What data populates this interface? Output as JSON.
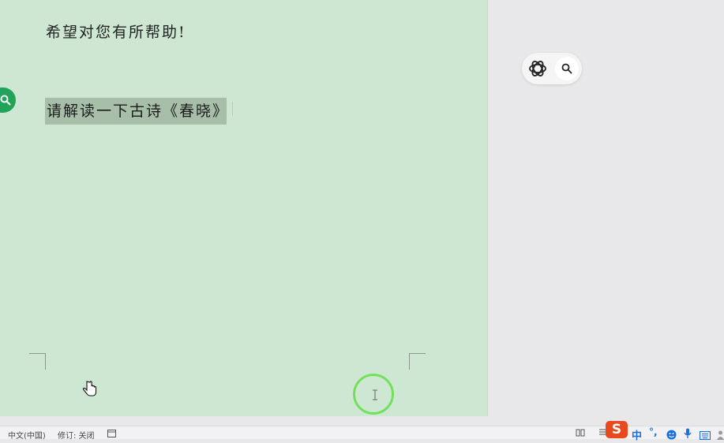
{
  "document": {
    "line1": "希望对您有所帮助!",
    "line2_selected": "请解读一下古诗《春晓》"
  },
  "cursor": {
    "ibeam": "I"
  },
  "statusbar": {
    "language": "中文(中国)",
    "track_changes": "修订: 关闭"
  },
  "ime": {
    "logo": "S",
    "mode": "中",
    "punct": "°,"
  },
  "icons": {
    "side": "search-icon",
    "ai": "openai-logo-icon",
    "float_search": "search-icon"
  },
  "colors": {
    "page_bg": "#cde7d2",
    "selection": "#a7bfa9",
    "side_button": "#21a35a",
    "click_ring": "#73e05a",
    "ime_logo": "#e8491d",
    "ime_blue": "#1a6fe0"
  }
}
